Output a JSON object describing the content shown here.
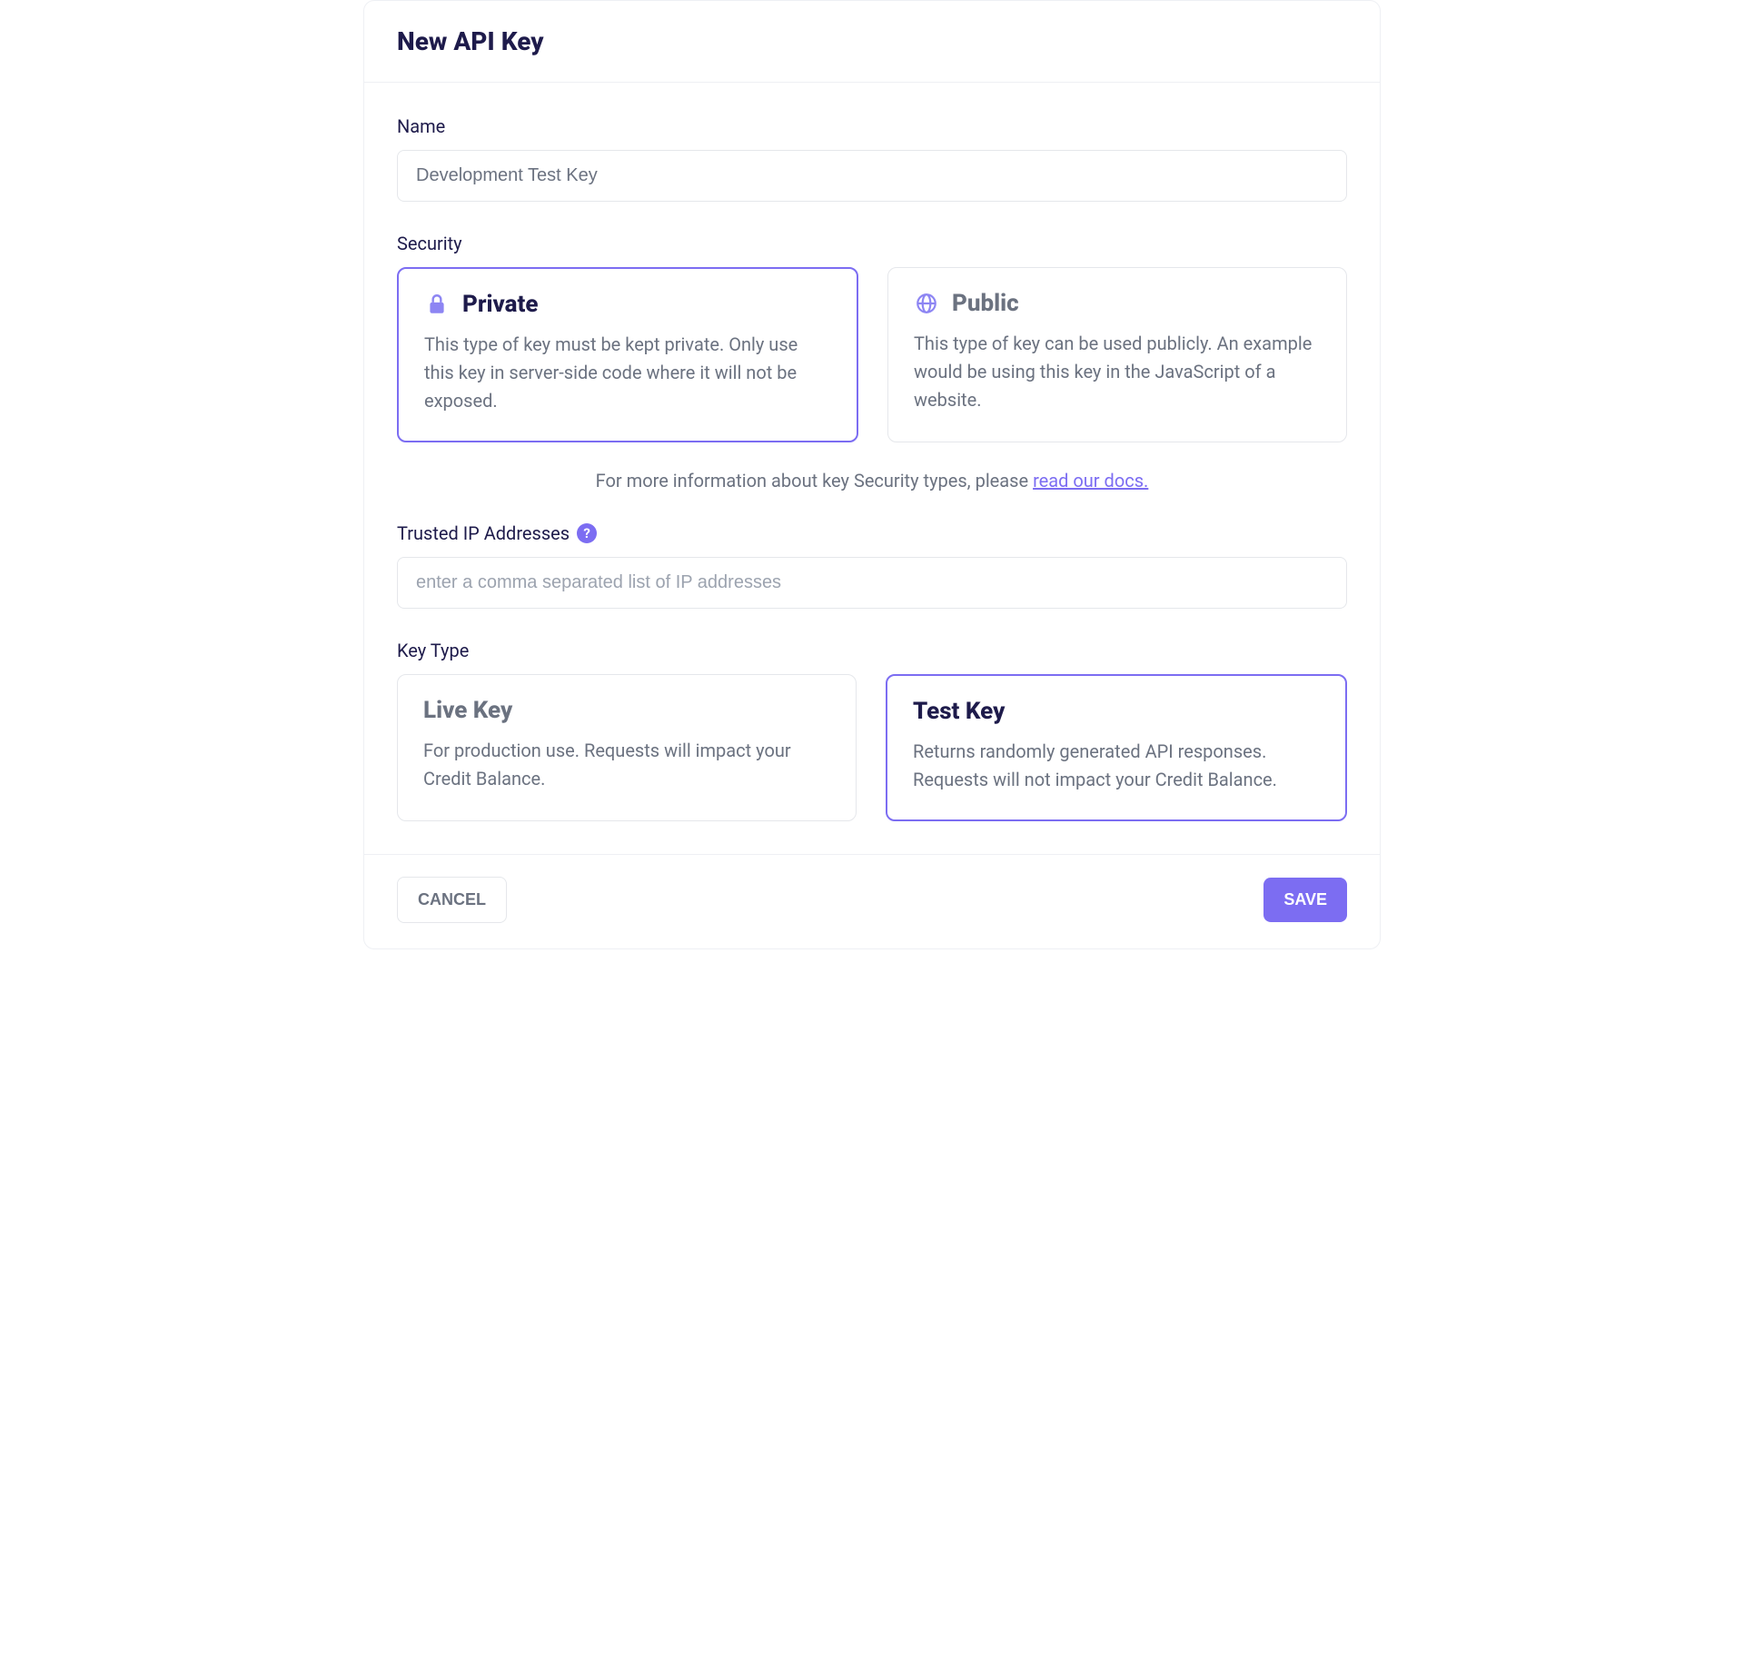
{
  "header": {
    "title": "New API Key"
  },
  "name_field": {
    "label": "Name",
    "value": "Development Test Key"
  },
  "security": {
    "label": "Security",
    "options": [
      {
        "title": "Private",
        "description": "This type of key must be kept private. Only use this key in server-side code where it will not be exposed.",
        "selected": true
      },
      {
        "title": "Public",
        "description": "This type of key can be used publicly. An example would be using this key in the JavaScript of a website.",
        "selected": false
      }
    ],
    "info_prefix": "For more information about key Security types, please ",
    "info_link": "read our docs."
  },
  "trusted_ip": {
    "label": "Trusted IP Addresses",
    "help": "?",
    "placeholder": "enter a comma separated list of IP addresses",
    "value": ""
  },
  "key_type": {
    "label": "Key Type",
    "options": [
      {
        "title": "Live Key",
        "description": "For production use. Requests will impact your Credit Balance.",
        "selected": false
      },
      {
        "title": "Test Key",
        "description": "Returns randomly generated API responses. Requests will not impact your Credit Balance.",
        "selected": true
      }
    ]
  },
  "footer": {
    "cancel": "CANCEL",
    "save": "SAVE"
  }
}
